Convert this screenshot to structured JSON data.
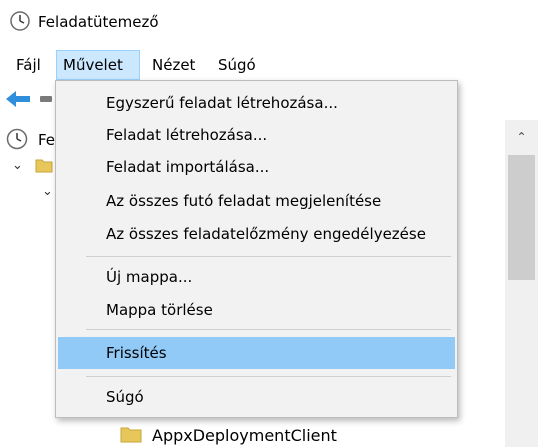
{
  "window": {
    "title": "Feladatütemező"
  },
  "menubar": {
    "items": [
      {
        "label": "Fájl"
      },
      {
        "label": "Művelet"
      },
      {
        "label": "Nézet"
      },
      {
        "label": "Súgó"
      }
    ],
    "active": "Művelet"
  },
  "tree": {
    "root_label_partial": "Fe",
    "visible_folder": "AppxDeploymentClient"
  },
  "action_menu": {
    "items": [
      {
        "label": "Egyszerű feladat létrehozása..."
      },
      {
        "label": "Feladat létrehozása..."
      },
      {
        "label": "Feladat importálása..."
      },
      {
        "label": "Az összes futó feladat megjelenítése"
      },
      {
        "label": "Az összes feladatelőzmény engedélyezése"
      },
      {
        "label": "Új mappa..."
      },
      {
        "label": "Mappa törlése"
      },
      {
        "label": "Frissítés"
      },
      {
        "label": "Súgó"
      }
    ],
    "highlighted": "Frissítés"
  },
  "colors": {
    "menu_bg": "#f2f2f2",
    "highlight": "#91c9f7",
    "active_menu_bg": "#cce8ff",
    "folder": "#e8c75a"
  },
  "icons": [
    "clock-icon",
    "back-arrow-icon",
    "folder-icon",
    "chevron-down-icon",
    "chevron-up-icon"
  ]
}
